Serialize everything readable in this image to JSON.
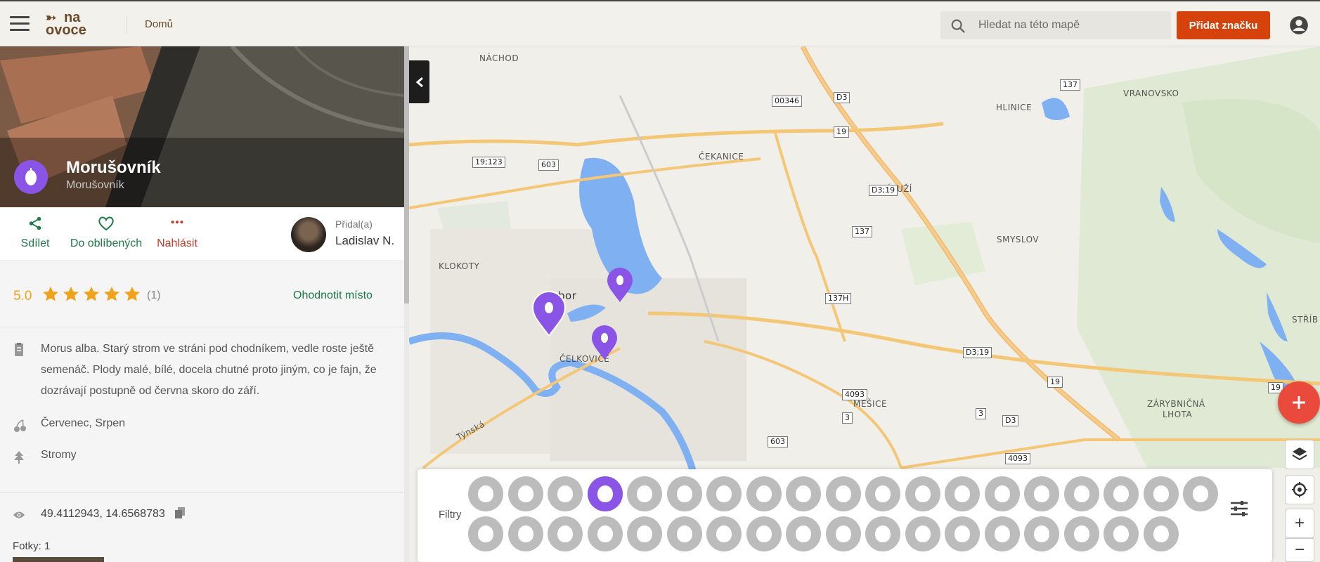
{
  "header": {
    "logo_line1": "na",
    "logo_line2": "ovoce",
    "nav_home": "Domů",
    "search_placeholder": "Hledat na této mapě",
    "add_marker": "Přidat značku"
  },
  "place": {
    "title": "Morušovník",
    "subtitle": "Morušovník",
    "actions": {
      "share": "Sdílet",
      "favorite": "Do oblíbených",
      "report": "Nahlásit"
    },
    "added_by_label": "Přidal(a)",
    "added_by_name": "Ladislav N.",
    "rating": {
      "score": "5.0",
      "stars": 5,
      "count": "(1)",
      "rate_link": "Ohodnotit místo"
    },
    "description": "Morus alba. Starý strom ve stráni pod chodníkem, vedle roste ještě semenáč. Plody malé, bílé, docela chutné proto jiným, co je fajn, že dozrávají postupně od června skoro do září.",
    "season": "Červenec, Srpen",
    "type": "Stromy",
    "coordinates": "49.4112943, 14.6568783",
    "photos": "Fotky: 1"
  },
  "map": {
    "labels": [
      {
        "text": "NÁCHOD"
      },
      {
        "text": "ČEKANICE"
      },
      {
        "text": "ZÁLUŽÍ"
      },
      {
        "text": "HLINICE"
      },
      {
        "text": "VRANOVSKO"
      },
      {
        "text": "SMYSLOV"
      },
      {
        "text": "KLOKOTY"
      },
      {
        "text": "bor"
      },
      {
        "text": "ČELKOVICE"
      },
      {
        "text": "MĚŠICE"
      },
      {
        "text": "ZÁRYBNIČNÁ"
      },
      {
        "text": "LHOTA"
      },
      {
        "text": "STŘÍB"
      },
      {
        "text": "Týnská"
      }
    ],
    "shields": [
      "00346",
      "D3",
      "19",
      "137",
      "19;123",
      "603",
      "D3;19",
      "137",
      "137H",
      "D3;19",
      "4093",
      "19",
      "3",
      "3",
      "D3",
      "603",
      "4093",
      "19"
    ],
    "zoom_in": "+",
    "zoom_out": "−"
  },
  "filters": {
    "label": "Filtry",
    "active_index": 3
  }
}
